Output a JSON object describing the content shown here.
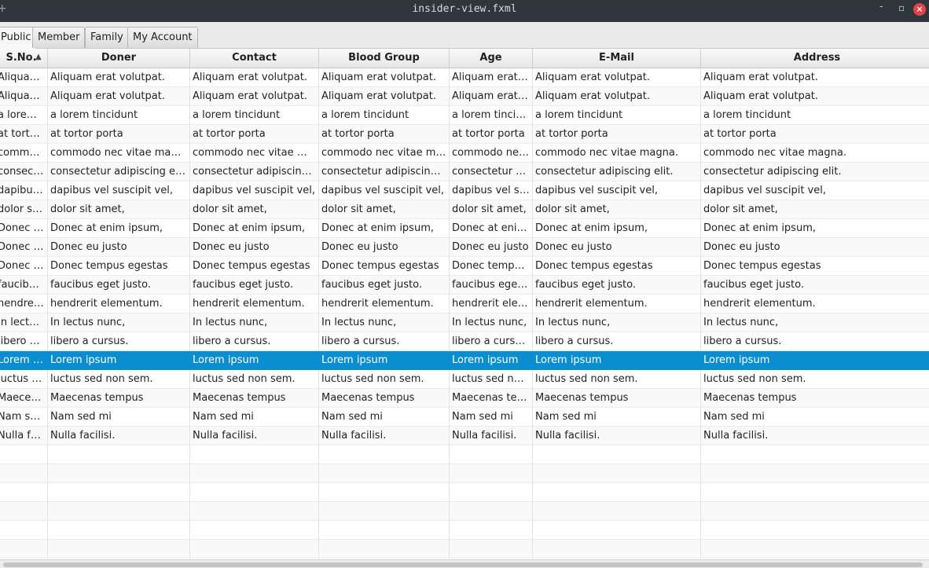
{
  "window": {
    "title": "insider-view.fxml",
    "pin_icon": "+",
    "minimize_icon": "-",
    "restore_icon": "▫",
    "close_icon": "×"
  },
  "tabs": [
    {
      "label": "Public",
      "active": true
    },
    {
      "label": "Member",
      "active": false
    },
    {
      "label": "Family",
      "active": false
    },
    {
      "label": "My Account",
      "active": false
    }
  ],
  "table": {
    "columns": [
      "S.No.",
      "Doner",
      "Contact",
      "Blood Group",
      "Age",
      "E-Mail",
      "Address"
    ],
    "sort_indicator": "▲",
    "selected_row": 15,
    "rows": [
      [
        "Aliquam erat volutpat.",
        "Aliquam erat volutpat.",
        "Aliquam erat volutpat.",
        "Aliquam erat volutpat.",
        "Aliquam erat volutpat.",
        "Aliquam erat volutpat.",
        "Aliquam erat volutpat."
      ],
      [
        "Aliquam erat volutpat.",
        "Aliquam erat volutpat.",
        "Aliquam erat volutpat.",
        "Aliquam erat volutpat.",
        "Aliquam erat volutpat.",
        "Aliquam erat volutpat.",
        "Aliquam erat volutpat."
      ],
      [
        "a lorem tincidunt",
        "a lorem tincidunt",
        "a lorem tincidunt",
        "a lorem tincidunt",
        "a lorem tincidunt",
        "a lorem tincidunt",
        "a lorem tincidunt"
      ],
      [
        "at tortor porta",
        "at tortor porta",
        "at tortor porta",
        "at tortor porta",
        "at tortor porta",
        "at tortor porta",
        "at tortor porta"
      ],
      [
        "commodo nec vitae magna.",
        "commodo nec vitae magna.",
        "commodo nec vitae magna.",
        "commodo nec vitae magna.",
        "commodo nec vitae magna.",
        "commodo nec vitae magna.",
        "commodo nec vitae magna."
      ],
      [
        "consectetur adipiscing elit.",
        "consectetur adipiscing elit.",
        "consectetur adipiscing elit.",
        "consectetur adipiscing elit.",
        "consectetur adipiscing elit.",
        "consectetur adipiscing elit.",
        "consectetur adipiscing elit."
      ],
      [
        "dapibus vel suscipit vel,",
        "dapibus vel suscipit vel,",
        "dapibus vel suscipit vel,",
        "dapibus vel suscipit vel,",
        "dapibus vel suscipit vel,",
        "dapibus vel suscipit vel,",
        "dapibus vel suscipit vel,"
      ],
      [
        "dolor sit amet,",
        "dolor sit amet,",
        "dolor sit amet,",
        "dolor sit amet,",
        "dolor sit amet,",
        "dolor sit amet,",
        "dolor sit amet,"
      ],
      [
        "Donec at enim ipsum,",
        "Donec at enim ipsum,",
        "Donec at enim ipsum,",
        "Donec at enim ipsum,",
        "Donec at enim ipsum,",
        "Donec at enim ipsum,",
        "Donec at enim ipsum,"
      ],
      [
        "Donec eu justo",
        "Donec eu justo",
        "Donec eu justo",
        "Donec eu justo",
        "Donec eu justo",
        "Donec eu justo",
        "Donec eu justo"
      ],
      [
        "Donec tempus egestas",
        "Donec tempus egestas",
        "Donec tempus egestas",
        "Donec tempus egestas",
        "Donec tempus egestas",
        "Donec tempus egestas",
        "Donec tempus egestas"
      ],
      [
        "faucibus eget justo.",
        "faucibus eget justo.",
        "faucibus eget justo.",
        "faucibus eget justo.",
        "faucibus eget justo.",
        "faucibus eget justo.",
        "faucibus eget justo."
      ],
      [
        "hendrerit elementum.",
        "hendrerit elementum.",
        "hendrerit elementum.",
        "hendrerit elementum.",
        "hendrerit elementum.",
        "hendrerit elementum.",
        "hendrerit elementum."
      ],
      [
        "In lectus nunc,",
        "In lectus nunc,",
        "In lectus nunc,",
        "In lectus nunc,",
        "In lectus nunc,",
        "In lectus nunc,",
        "In lectus nunc,"
      ],
      [
        "libero a cursus.",
        "libero a cursus.",
        "libero a cursus.",
        "libero a cursus.",
        "libero a cursus.",
        "libero a cursus.",
        "libero a cursus."
      ],
      [
        "Lorem ipsum",
        "Lorem ipsum",
        "Lorem ipsum",
        "Lorem ipsum",
        "Lorem ipsum",
        "Lorem ipsum",
        "Lorem ipsum"
      ],
      [
        "luctus sed non sem.",
        "luctus sed non sem.",
        "luctus sed non sem.",
        "luctus sed non sem.",
        "luctus sed non sem.",
        "luctus sed non sem.",
        "luctus sed non sem."
      ],
      [
        "Maecenas tempus",
        "Maecenas tempus",
        "Maecenas tempus",
        "Maecenas tempus",
        "Maecenas tempus",
        "Maecenas tempus",
        "Maecenas tempus"
      ],
      [
        "Nam sed mi",
        "Nam sed mi",
        "Nam sed mi",
        "Nam sed mi",
        "Nam sed mi",
        "Nam sed mi",
        "Nam sed mi"
      ],
      [
        "Nulla facilisi.",
        "Nulla facilisi.",
        "Nulla facilisi.",
        "Nulla facilisi.",
        "Nulla facilisi.",
        "Nulla facilisi.",
        "Nulla facilisi."
      ]
    ]
  },
  "colors": {
    "titlebar": "#30363c",
    "selection": "#0a8ed0",
    "close_button": "#e8424b"
  }
}
